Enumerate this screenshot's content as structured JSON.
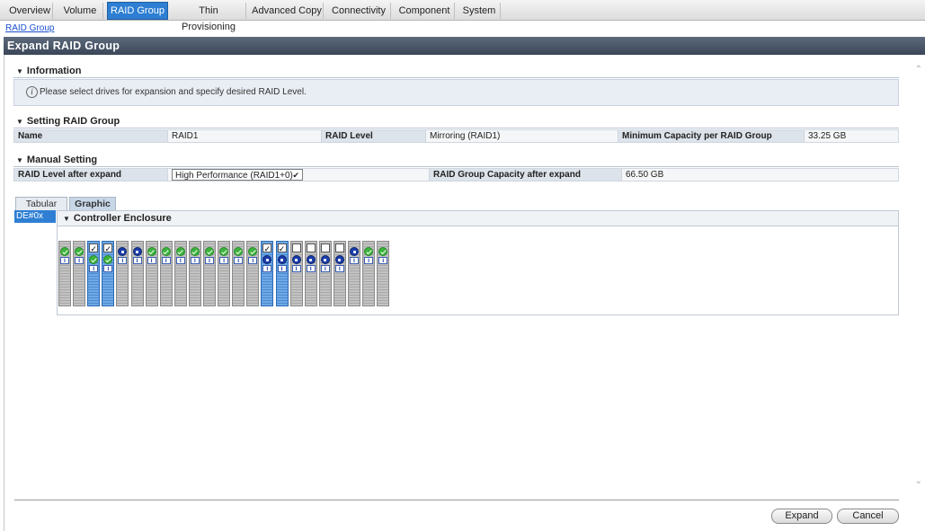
{
  "top_tabs": [
    {
      "label": "Overview",
      "active": false
    },
    {
      "label": "Volume",
      "active": false
    },
    {
      "label": "RAID Group",
      "active": true
    },
    {
      "label": "Thin Provisioning",
      "active": false
    },
    {
      "label": "Advanced Copy",
      "active": false
    },
    {
      "label": "Connectivity",
      "active": false
    },
    {
      "label": "Component",
      "active": false
    },
    {
      "label": "System",
      "active": false
    }
  ],
  "breadcrumb": "RAID Group",
  "page_title": "Expand RAID Group",
  "information": {
    "title": "Information",
    "message": "Please select drives for expansion and specify desired RAID Level."
  },
  "setting": {
    "title": "Setting RAID Group",
    "name_label": "Name",
    "name_value": "RAID1",
    "level_label": "RAID Level",
    "level_value": "Mirroring (RAID1)",
    "mincap_label": "Minimum Capacity per RAID Group",
    "mincap_value": "33.25 GB"
  },
  "manual": {
    "title": "Manual Setting",
    "level_after_label": "RAID Level after expand",
    "level_after_value": "High Performance (RAID1+0)",
    "capacity_label": "RAID Group Capacity after expand",
    "capacity_value": "66.50 GB"
  },
  "view_tabs": [
    {
      "label": "Tabular",
      "active": false
    },
    {
      "label": "Graphic",
      "active": true
    }
  ],
  "de_label": "DE#0x",
  "enclosure_title": "Controller Enclosure",
  "drives": [
    {
      "cb": "none",
      "status": "ok",
      "selected": false
    },
    {
      "cb": "none",
      "status": "ok",
      "selected": false
    },
    {
      "cb": "checked",
      "status": "ok",
      "selected": true
    },
    {
      "cb": "checked",
      "status": "ok",
      "selected": true
    },
    {
      "cb": "none",
      "status": "available",
      "selected": false
    },
    {
      "cb": "none",
      "status": "available",
      "selected": false
    },
    {
      "cb": "none",
      "status": "ok",
      "selected": false
    },
    {
      "cb": "none",
      "status": "ok",
      "selected": false
    },
    {
      "cb": "none",
      "status": "ok",
      "selected": false
    },
    {
      "cb": "none",
      "status": "ok",
      "selected": false
    },
    {
      "cb": "none",
      "status": "ok",
      "selected": false
    },
    {
      "cb": "none",
      "status": "ok",
      "selected": false
    },
    {
      "cb": "none",
      "status": "ok",
      "selected": false
    },
    {
      "cb": "none",
      "status": "ok",
      "selected": false
    },
    {
      "cb": "checked",
      "status": "available",
      "selected": true
    },
    {
      "cb": "checked",
      "status": "available",
      "selected": true
    },
    {
      "cb": "unchecked",
      "status": "available",
      "selected": false
    },
    {
      "cb": "unchecked",
      "status": "available",
      "selected": false
    },
    {
      "cb": "unchecked",
      "status": "available",
      "selected": false
    },
    {
      "cb": "unchecked",
      "status": "available",
      "selected": false
    },
    {
      "cb": "none",
      "status": "available",
      "selected": false
    },
    {
      "cb": "none",
      "status": "ok",
      "selected": false
    },
    {
      "cb": "none",
      "status": "ok",
      "selected": false
    }
  ],
  "buttons": {
    "expand": "Expand",
    "cancel": "Cancel"
  },
  "icons": {
    "info": "info-circle-icon",
    "check": "check-mark-glyph"
  },
  "colors": {
    "accent": "#2e7fd3",
    "header": "#4a5669",
    "ok": "#3cb43c",
    "available": "#1a3da8"
  }
}
